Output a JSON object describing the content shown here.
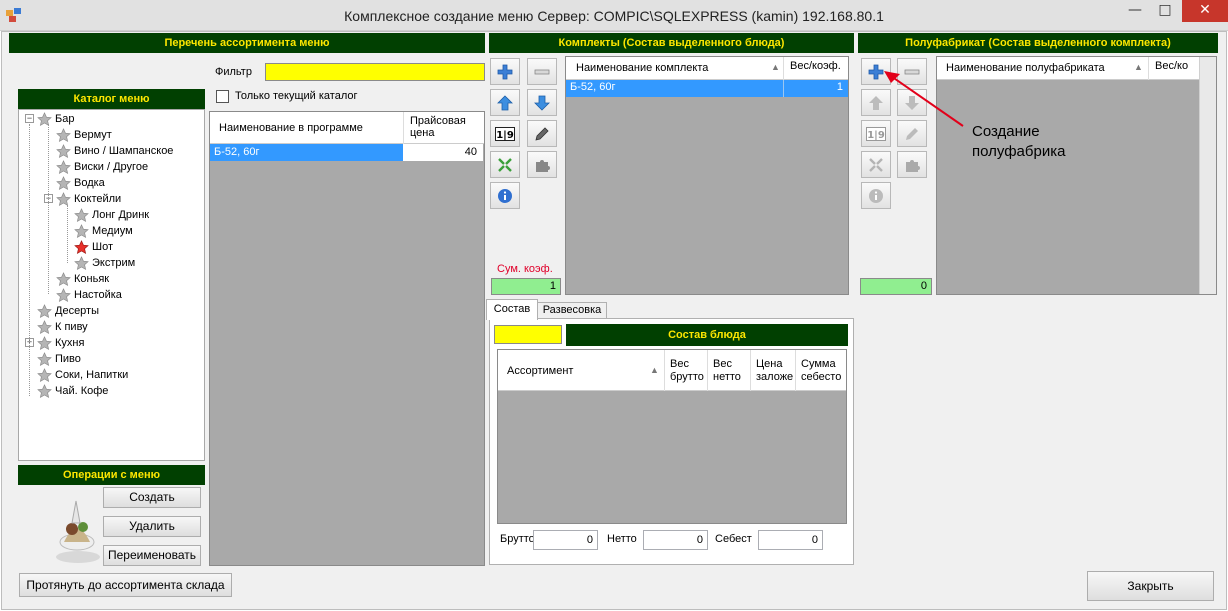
{
  "window": {
    "title": "Комплексное создание меню  Сервер: COMPIC\\SQLEXPRESS (kamin) 192.168.80.1",
    "min": "—",
    "max": "□",
    "close": "✕"
  },
  "assortment": {
    "header": "Перечень ассортимента меню",
    "filter_label": "Фильтр",
    "filter_value": "",
    "only_current_label": "Только текущий каталог",
    "columns": [
      "Наименование в программе",
      "Прайсовая цена"
    ],
    "rows": [
      {
        "name": "Б-52, 60г",
        "price": "40"
      }
    ]
  },
  "catalog": {
    "header": "Каталог меню",
    "nodes": [
      "Бар",
      "Вермут",
      "Вино / Шампанское",
      "Виски / Другое",
      "Водка",
      "Коктейли",
      "Лонг Дринк",
      "Медиум",
      "Шот",
      "Экстрим",
      "Коньяк",
      "Настойка",
      "Десерты",
      "К пиву",
      "Кухня",
      "Пиво",
      "Соки, Напитки",
      "Чай. Кофе"
    ]
  },
  "operations": {
    "header": "Операции с меню",
    "create": "Создать",
    "delete": "Удалить",
    "rename": "Переименовать"
  },
  "kits": {
    "header": "Комплекты (Состав выделенного блюда)",
    "columns": [
      "Наименование комплекта",
      "Вес/коэф."
    ],
    "rows": [
      {
        "name": "Б-52, 60г",
        "coef": "1"
      }
    ],
    "sum_label": "Сум. коэф.",
    "sum_value": "1"
  },
  "semi": {
    "header": "Полуфабрикат (Состав выделенного комплекта)",
    "columns": [
      "Наименование полуфабриката",
      "Вес/ко"
    ],
    "sum_value": "0",
    "annotation": [
      "Создание",
      "полуфабрика"
    ]
  },
  "composition": {
    "tabs": [
      "Состав",
      "Развесовка"
    ],
    "header": "Состав блюда",
    "columns": [
      "Ассортимент",
      "Вес брутто",
      "Вес нетто",
      "Цена заложе",
      "Сумма себесто"
    ],
    "brutto_label": "Брутто",
    "brutto_value": "0",
    "netto_label": "Нетто",
    "netto_value": "0",
    "sebest_label": "Себест",
    "sebest_value": "0"
  },
  "footer": {
    "stretch": "Протянуть до ассортимента склада",
    "close": "Закрыть"
  }
}
